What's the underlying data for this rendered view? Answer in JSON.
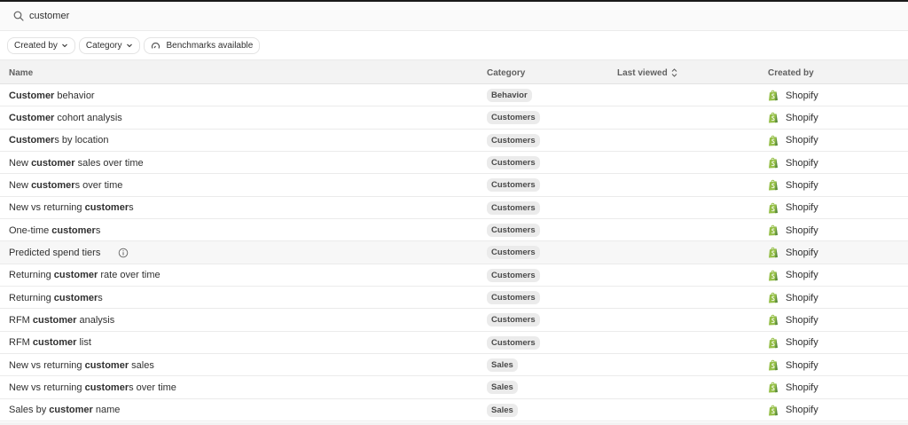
{
  "search": {
    "value": "customer",
    "placeholder": ""
  },
  "filters": [
    {
      "label": "Created by",
      "has_chevron": true
    },
    {
      "label": "Category",
      "has_chevron": true
    },
    {
      "label": "Benchmarks available",
      "icon": "gauge-icon"
    }
  ],
  "table": {
    "columns": {
      "name": "Name",
      "category": "Category",
      "last_viewed": "Last viewed",
      "created_by": "Created by"
    },
    "rows": [
      {
        "name_parts": [
          [
            "Customer",
            true
          ],
          [
            " behavior",
            false
          ]
        ],
        "category": "Behavior",
        "created_by": "Shopify"
      },
      {
        "name_parts": [
          [
            "Customer",
            true
          ],
          [
            " cohort analysis",
            false
          ]
        ],
        "category": "Customers",
        "created_by": "Shopify"
      },
      {
        "name_parts": [
          [
            "Customer",
            true
          ],
          [
            "s by location",
            false
          ]
        ],
        "category": "Customers",
        "created_by": "Shopify"
      },
      {
        "name_parts": [
          [
            "New ",
            false
          ],
          [
            "customer",
            true
          ],
          [
            " sales over time",
            false
          ]
        ],
        "category": "Customers",
        "created_by": "Shopify"
      },
      {
        "name_parts": [
          [
            "New ",
            false
          ],
          [
            "customer",
            true
          ],
          [
            "s over time",
            false
          ]
        ],
        "category": "Customers",
        "created_by": "Shopify"
      },
      {
        "name_parts": [
          [
            "New vs returning ",
            false
          ],
          [
            "customer",
            true
          ],
          [
            "s",
            false
          ]
        ],
        "category": "Customers",
        "created_by": "Shopify"
      },
      {
        "name_parts": [
          [
            "One-time ",
            false
          ],
          [
            "customer",
            true
          ],
          [
            "s",
            false
          ]
        ],
        "category": "Customers",
        "created_by": "Shopify"
      },
      {
        "name_parts": [
          [
            "Predicted spend tiers",
            false
          ]
        ],
        "category": "Customers",
        "created_by": "Shopify",
        "info": true,
        "hover": true
      },
      {
        "name_parts": [
          [
            "Returning ",
            false
          ],
          [
            "customer",
            true
          ],
          [
            " rate over time",
            false
          ]
        ],
        "category": "Customers",
        "created_by": "Shopify"
      },
      {
        "name_parts": [
          [
            "Returning ",
            false
          ],
          [
            "customer",
            true
          ],
          [
            "s",
            false
          ]
        ],
        "category": "Customers",
        "created_by": "Shopify"
      },
      {
        "name_parts": [
          [
            "RFM ",
            false
          ],
          [
            "customer",
            true
          ],
          [
            " analysis",
            false
          ]
        ],
        "category": "Customers",
        "created_by": "Shopify"
      },
      {
        "name_parts": [
          [
            "RFM ",
            false
          ],
          [
            "customer",
            true
          ],
          [
            " list",
            false
          ]
        ],
        "category": "Customers",
        "created_by": "Shopify"
      },
      {
        "name_parts": [
          [
            "New vs returning ",
            false
          ],
          [
            "customer",
            true
          ],
          [
            " sales",
            false
          ]
        ],
        "category": "Sales",
        "created_by": "Shopify"
      },
      {
        "name_parts": [
          [
            "New vs returning ",
            false
          ],
          [
            "customer",
            true
          ],
          [
            "s over time",
            false
          ]
        ],
        "category": "Sales",
        "created_by": "Shopify"
      },
      {
        "name_parts": [
          [
            "Sales by ",
            false
          ],
          [
            "customer",
            true
          ],
          [
            " name",
            false
          ]
        ],
        "category": "Sales",
        "created_by": "Shopify"
      }
    ]
  },
  "colors": {
    "shopify_green": "#95bf47",
    "shopify_dark": "#5e8e3e",
    "badge_bg": "#ebebeb"
  }
}
